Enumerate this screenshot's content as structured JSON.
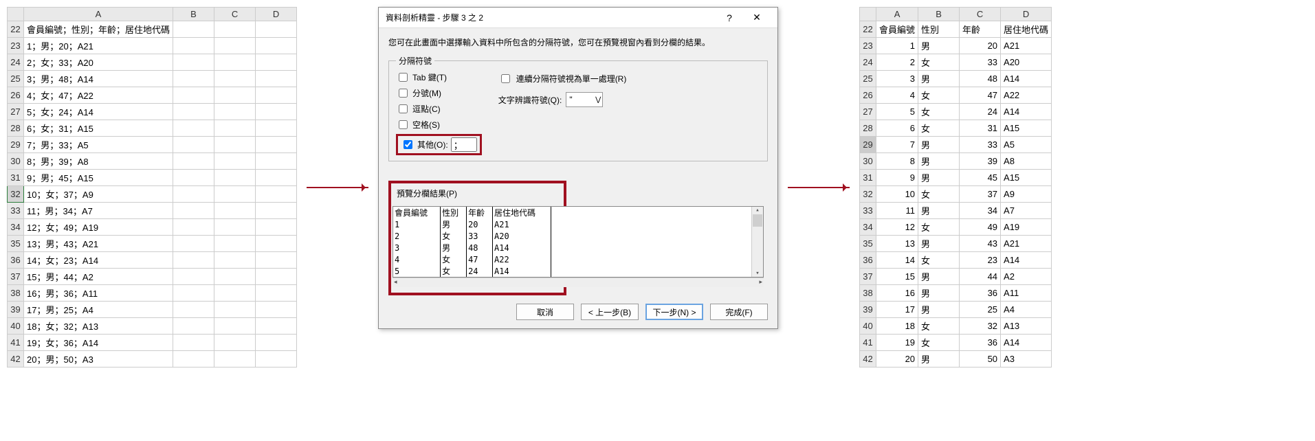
{
  "left_sheet": {
    "col_headers": [
      "A",
      "B",
      "C",
      "D"
    ],
    "row_start": 22,
    "rows": [
      "會員編號；性別；年齡；居住地代碼",
      "1；男；20；A21",
      "2；女；33；A20",
      "3；男；48；A14",
      "4；女；47；A22",
      "5；女；24；A14",
      "6；女；31；A15",
      "7；男；33；A5",
      "8；男；39；A8",
      "9；男；45；A15",
      "10；女；37；A9",
      "11；男；34；A7",
      "12；女；49；A19",
      "13；男；43；A21",
      "14；女；23；A14",
      "15；男；44；A2",
      "16；男；36；A11",
      "17；男；25；A4",
      "18；女；32；A13",
      "19；女；36；A14",
      "20；男；50；A3"
    ],
    "active_row": 32
  },
  "dialog": {
    "title": "資料剖析精靈 - 步驟 3 之 2",
    "hint": "您可在此畫面中選擇輸入資料中所包含的分隔符號，您可在預覽視窗內看到分欄的結果。",
    "delim_legend": "分隔符號",
    "tab_label": "Tab 鍵(T)",
    "semicolon_label": "分號(M)",
    "comma_label": "逗點(C)",
    "space_label": "空格(S)",
    "other_label": "其他(O):",
    "other_value": "；",
    "consecutive_label": "連續分隔符號視為單一處理(R)",
    "qualifier_label": "文字辨識符號(Q):",
    "qualifier_value": "\"",
    "preview_label": "預覽分欄結果(P)",
    "preview_headers": [
      "會員編號",
      "性別",
      "年齡",
      "居住地代碼"
    ],
    "preview_rows": [
      [
        "1",
        "男",
        "20",
        "A21"
      ],
      [
        "2",
        "女",
        "33",
        "A20"
      ],
      [
        "3",
        "男",
        "48",
        "A14"
      ],
      [
        "4",
        "女",
        "47",
        "A22"
      ],
      [
        "5",
        "女",
        "24",
        "A14"
      ]
    ],
    "btn_cancel": "取消",
    "btn_back": "< 上一步(B)",
    "btn_next": "下一步(N) >",
    "btn_finish": "完成(F)"
  },
  "right_sheet": {
    "col_headers": [
      "A",
      "B",
      "C",
      "D"
    ],
    "row_start": 22,
    "header_row": [
      "會員編號",
      "性別",
      "年齡",
      "居住地代碼"
    ],
    "rows": [
      [
        1,
        "男",
        20,
        "A21"
      ],
      [
        2,
        "女",
        33,
        "A20"
      ],
      [
        3,
        "男",
        48,
        "A14"
      ],
      [
        4,
        "女",
        47,
        "A22"
      ],
      [
        5,
        "女",
        24,
        "A14"
      ],
      [
        6,
        "女",
        31,
        "A15"
      ],
      [
        7,
        "男",
        33,
        "A5"
      ],
      [
        8,
        "男",
        39,
        "A8"
      ],
      [
        9,
        "男",
        45,
        "A15"
      ],
      [
        10,
        "女",
        37,
        "A9"
      ],
      [
        11,
        "男",
        34,
        "A7"
      ],
      [
        12,
        "女",
        49,
        "A19"
      ],
      [
        13,
        "男",
        43,
        "A21"
      ],
      [
        14,
        "女",
        23,
        "A14"
      ],
      [
        15,
        "男",
        44,
        "A2"
      ],
      [
        16,
        "男",
        36,
        "A11"
      ],
      [
        17,
        "男",
        25,
        "A4"
      ],
      [
        18,
        "女",
        32,
        "A13"
      ],
      [
        19,
        "女",
        36,
        "A14"
      ],
      [
        20,
        "男",
        50,
        "A3"
      ]
    ],
    "sel_row": 29
  }
}
